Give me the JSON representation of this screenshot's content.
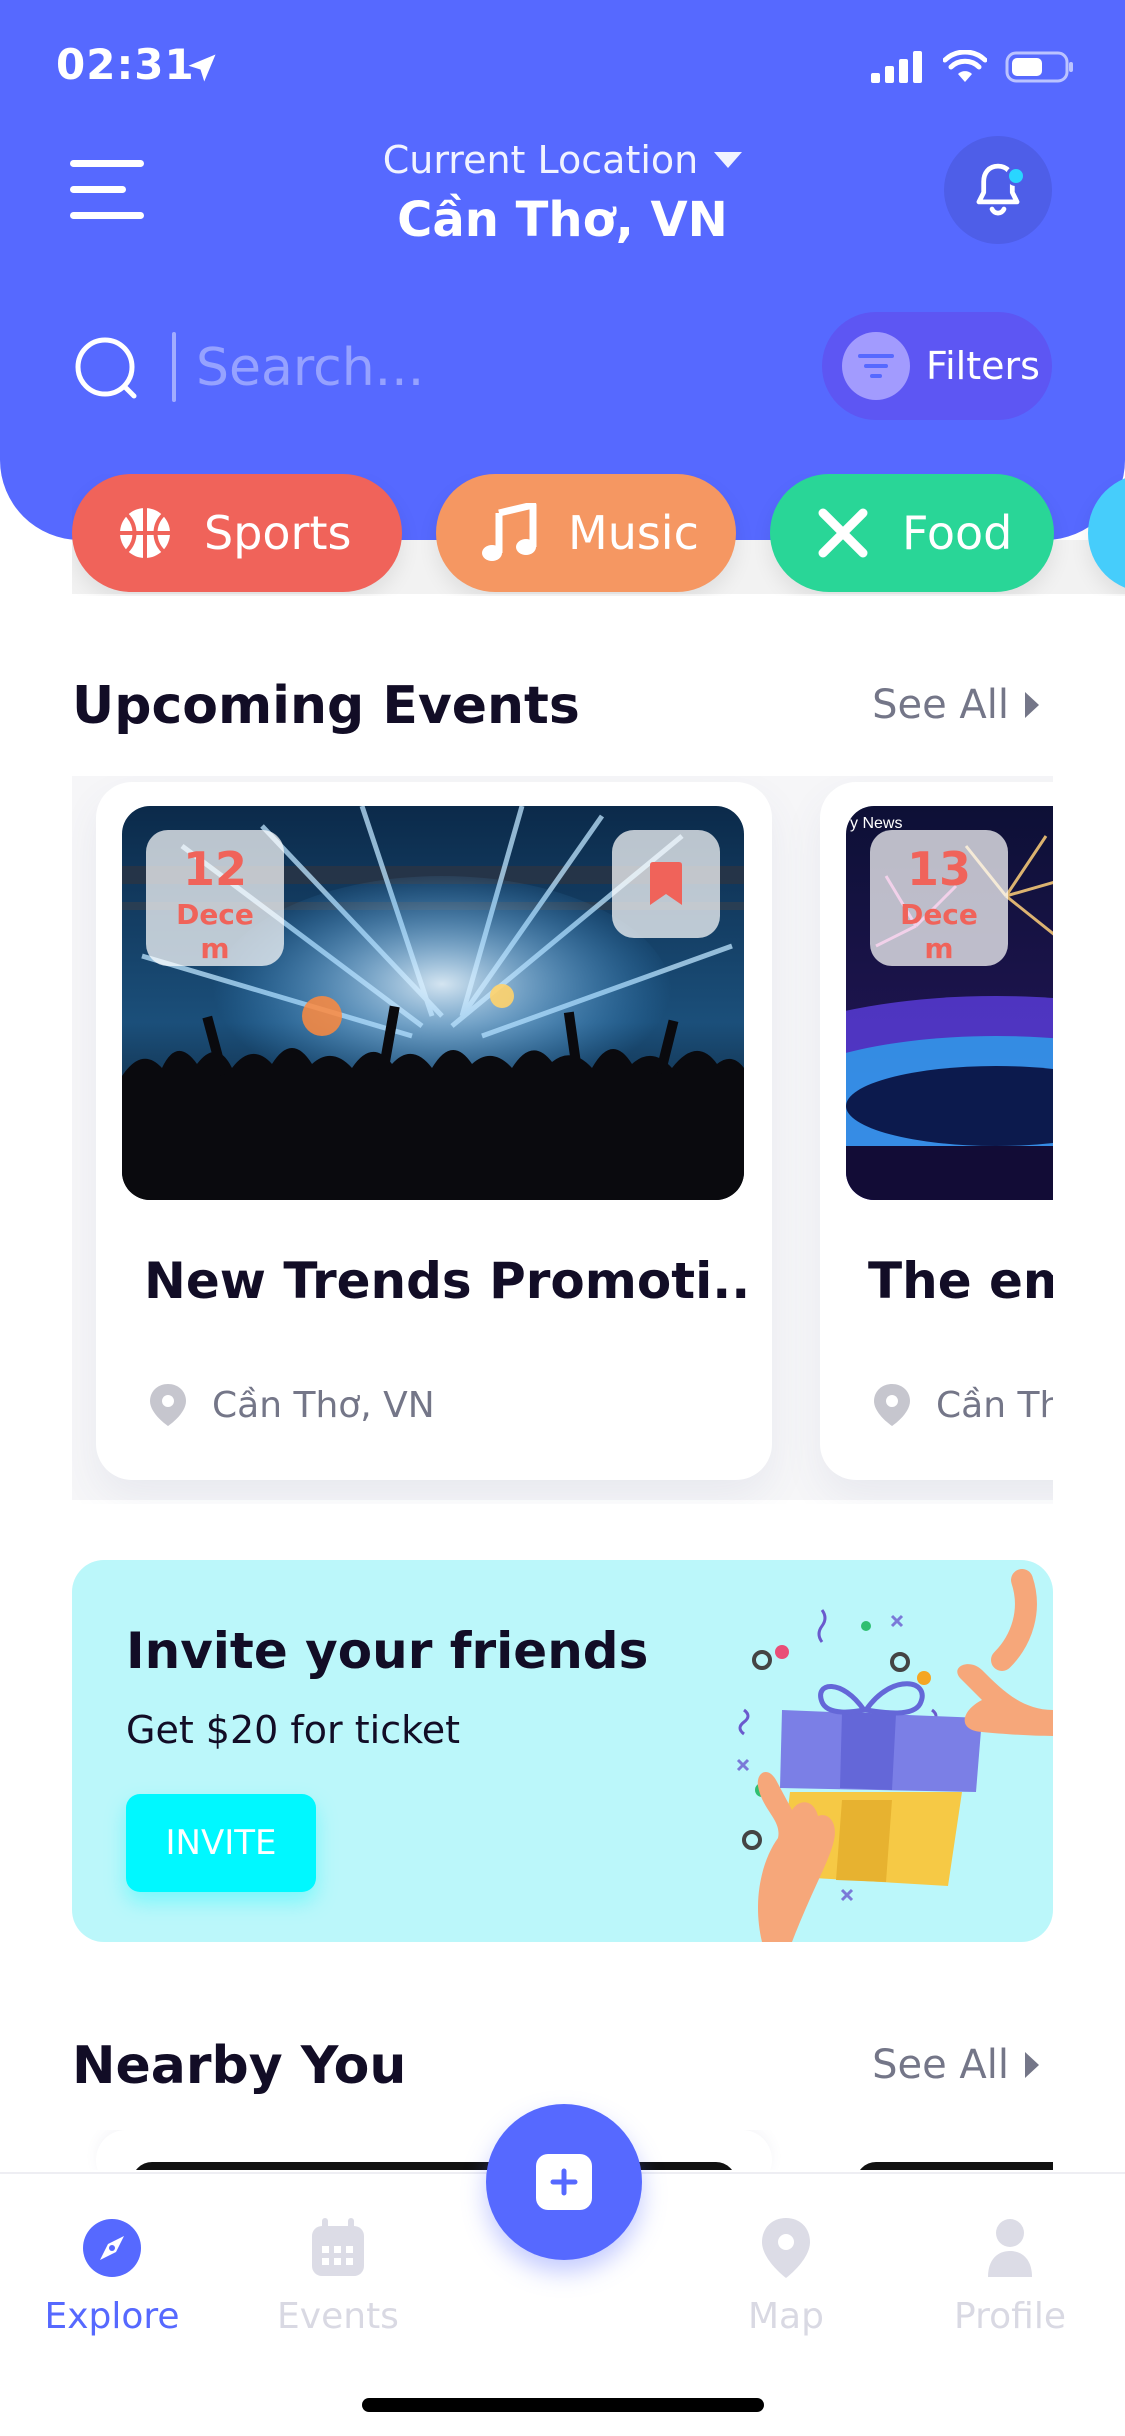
{
  "status_bar": {
    "time": "02:31"
  },
  "header": {
    "location_label": "Current Location",
    "location_city": "Cần Thơ, VN",
    "search_placeholder": "Search...",
    "filters_label": "Filters"
  },
  "categories": [
    {
      "label": "Sports",
      "color": "#f0635a",
      "icon": "basketball-icon"
    },
    {
      "label": "Music",
      "color": "#f59762",
      "icon": "music-note-icon"
    },
    {
      "label": "Food",
      "color": "#29d697",
      "icon": "food-icon"
    },
    {
      "label": "",
      "color": "#46cdfb",
      "icon": ""
    }
  ],
  "upcoming": {
    "title": "Upcoming Events",
    "see_all": "See All",
    "events": [
      {
        "day": "12",
        "month": "Decem",
        "title": "New Trends Promoti...",
        "location": "Cần Thơ, VN"
      },
      {
        "day": "13",
        "month": "Decem",
        "title": "The em",
        "location": "Cần Th"
      }
    ]
  },
  "invite": {
    "title": "Invite your friends",
    "subtitle": "Get $20 for ticket",
    "button": "INVITE"
  },
  "nearby": {
    "title": "Nearby You",
    "see_all": "See All"
  },
  "bottom_nav": {
    "items": [
      {
        "label": "Explore",
        "active": true
      },
      {
        "label": "Events",
        "active": false
      },
      {
        "label": "Map",
        "active": false
      },
      {
        "label": "Profile",
        "active": false
      }
    ]
  },
  "colors": {
    "primary": "#5669ff",
    "accent_red": "#f0635a",
    "invite_bg": "#bbf7fa",
    "invite_button": "#00f8ff"
  }
}
